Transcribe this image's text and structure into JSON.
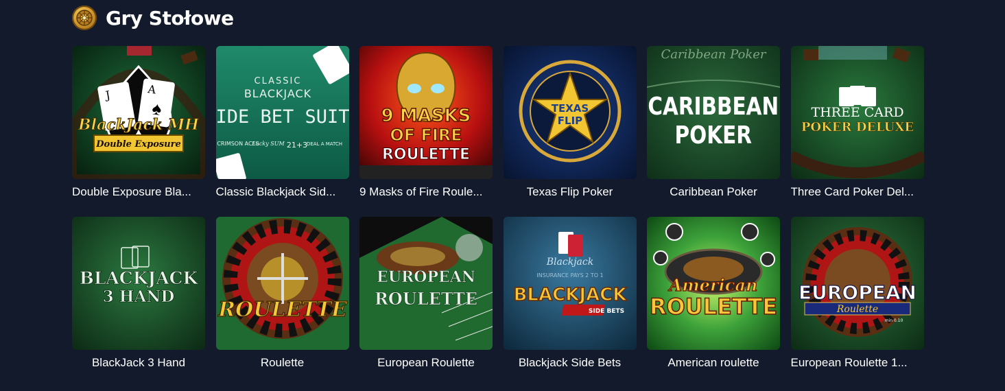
{
  "section": {
    "title": "Gry Stołowe",
    "icon": "roulette-wheel-icon"
  },
  "games": [
    {
      "name": "Double Exposure Bla...",
      "logo_lines": [
        "BlackJack MH",
        "Double Exposure"
      ],
      "align": "left"
    },
    {
      "name": "Classic Blackjack Sid...",
      "logo_lines": [
        "CLASSIC",
        "BLACKJACK",
        "SIDE BET SUITE",
        "CRIMSON ACES",
        "Lucky SUM",
        "21+3",
        "DEAL A MATCH"
      ],
      "align": "left"
    },
    {
      "name": "9 Masks of Fire Roule...",
      "logo_lines": [
        "9 MASKS",
        "OF FIRE",
        "ROULETTE"
      ],
      "align": "left"
    },
    {
      "name": "Texas Flip Poker",
      "logo_lines": [
        "TEXAS",
        "FLIP"
      ],
      "align": "center"
    },
    {
      "name": "Caribbean Poker",
      "logo_lines": [
        "Caribbean Poker",
        "CARIBBEAN",
        "POKER"
      ],
      "align": "center"
    },
    {
      "name": "Three Card Poker Del...",
      "logo_lines": [
        "THREE CARD",
        "POKER DELUXE"
      ],
      "align": "left"
    },
    {
      "name": "BlackJack 3 Hand",
      "logo_lines": [
        "BLACKJACK",
        "3 HAND"
      ],
      "align": "center"
    },
    {
      "name": "Roulette",
      "logo_lines": [
        "ROULETTE"
      ],
      "align": "center"
    },
    {
      "name": "European Roulette",
      "logo_lines": [
        "EUROPEAN",
        "ROULETTE"
      ],
      "align": "center"
    },
    {
      "name": "Blackjack Side Bets",
      "logo_lines": [
        "Blackjack",
        "INSURANCE PAYS 2 TO 1",
        "BLACKJACK",
        "SIDE BETS"
      ],
      "align": "center"
    },
    {
      "name": "American roulette",
      "logo_lines": [
        "American",
        "ROULETTE"
      ],
      "align": "center"
    },
    {
      "name": "European Roulette 1...",
      "logo_lines": [
        "EUROPEAN",
        "Roulette",
        "min 0.10"
      ],
      "align": "left"
    }
  ]
}
